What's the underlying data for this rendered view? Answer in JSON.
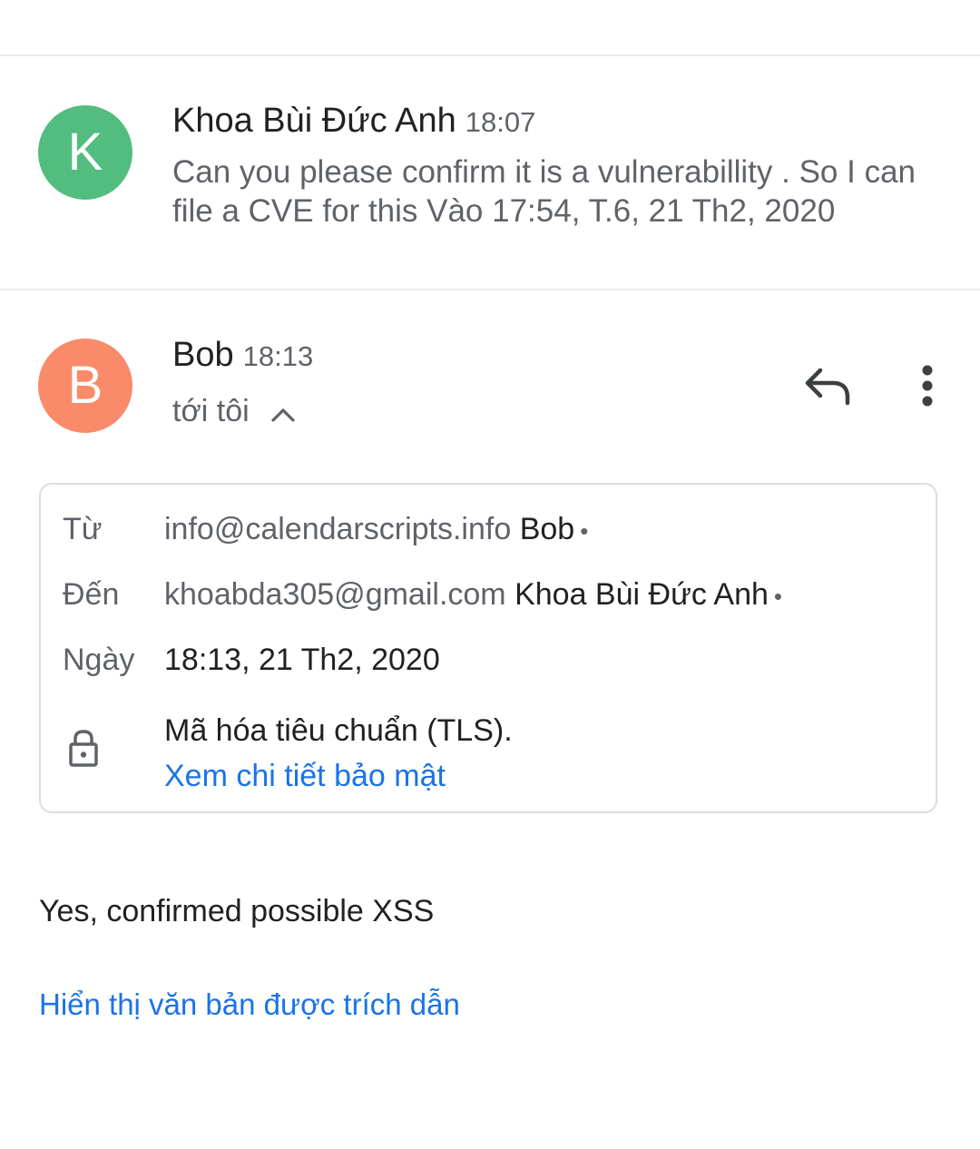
{
  "message1": {
    "avatar_letter": "K",
    "avatar_color": "#52bd7f",
    "sender_name": "Khoa Bùi Đức Anh",
    "time": "18:07",
    "snippet": "Can you please confirm it is a vulnerabillity . So I can file a CVE for this Vào 17:54, T.6, 21 Th2, 2020"
  },
  "message2": {
    "avatar_letter": "B",
    "avatar_color": "#f98a6a",
    "sender_name": "Bob",
    "time": "18:13",
    "recipient_label": "tới tôi",
    "icons": {
      "expand": "chevron-up-icon",
      "reply": "reply-icon",
      "more": "more-vert-icon"
    },
    "details": {
      "from_label": "Từ",
      "from_email": "info@calendarscripts.info",
      "from_name": "Bob",
      "to_label": "Đến",
      "to_email": "khoabda305@gmail.com",
      "to_name": "Khoa Bùi Đức Anh",
      "separator": "•",
      "date_label": "Ngày",
      "date_value": "18:13, 21 Th2, 2020",
      "encryption_text": "Mã hóa tiêu chuẩn (TLS).",
      "security_link": "Xem chi tiết bảo mật",
      "lock_icon": "lock-icon"
    },
    "body": "Yes, confirmed possible XSS",
    "quoted_link": "Hiển thị văn bản được trích dẫn"
  },
  "colors": {
    "link": "#1a73e8",
    "secondary_text": "#5f6368",
    "primary_text": "#202124",
    "divider": "#ececec"
  }
}
